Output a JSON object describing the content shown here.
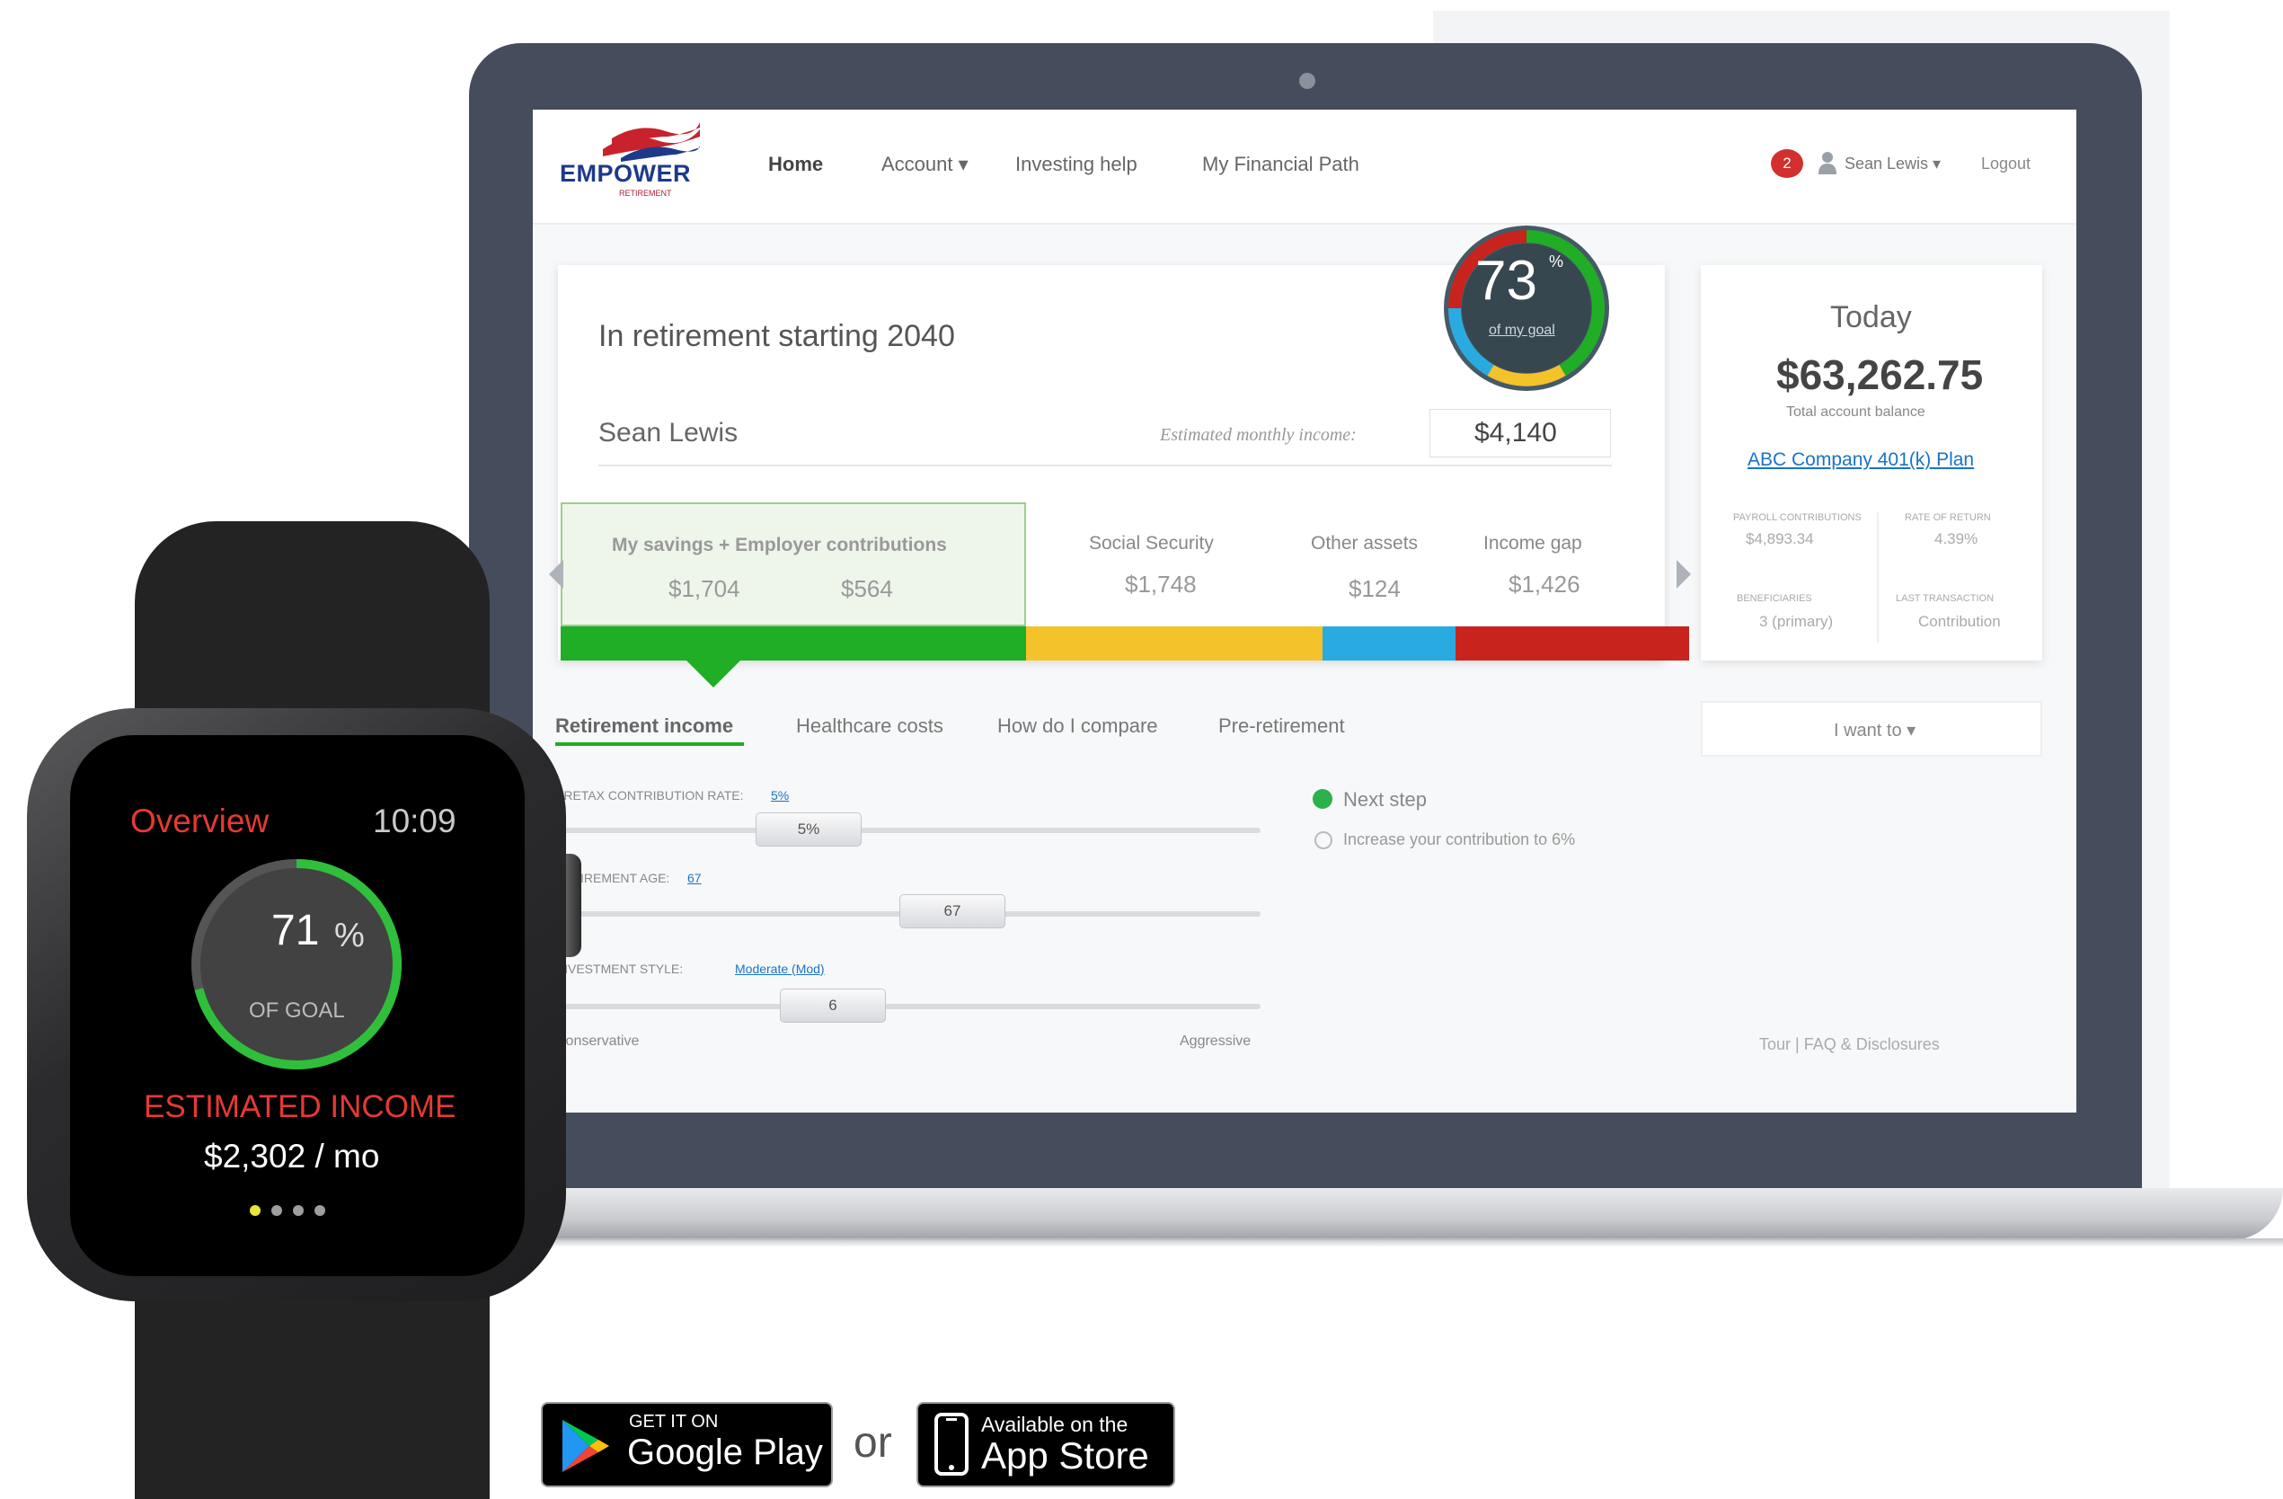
{
  "nav": {
    "logo": "EMPOWER",
    "logo_sub": "RETIREMENT",
    "home": "Home",
    "account": "Account ▾",
    "investing_help": "Investing help",
    "financial_path": "My Financial Path",
    "notification_count": "2",
    "user": "Sean Lewis ▾",
    "logout": "Logout"
  },
  "summary": {
    "title": "In retirement starting 2040",
    "name": "Sean Lewis",
    "est_label": "Estimated monthly income:",
    "est_value": "$4,140",
    "goal_percent": "73",
    "goal_percent_sign": "%",
    "goal_sub": "of my goal",
    "goal_fraction": 0.73
  },
  "breakdown": {
    "savings_label": "My savings  +  Employer contributions",
    "savings_value": "$1,704",
    "employer_value": "$564",
    "ss_label": "Social Security",
    "ss_value": "$1,748",
    "other_label": "Other assets",
    "other_value": "$124",
    "gap_label": "Income gap",
    "gap_value": "$1,426"
  },
  "today": {
    "title": "Today",
    "balance": "$63,262.75",
    "balance_label": "Total account balance",
    "plan_link": "ABC Company 401(k) Plan",
    "stats": [
      {
        "label": "PAYROLL CONTRIBUTIONS",
        "value": "$4,893.34"
      },
      {
        "label": "RATE OF RETURN",
        "value": "4.39%"
      },
      {
        "label": "BENEFICIARIES",
        "value": "3 (primary)"
      },
      {
        "label": "LAST TRANSACTION",
        "value": "Contribution"
      }
    ],
    "i_want_to": "I want to ▾"
  },
  "tabs": [
    "Retirement income",
    "Healthcare costs",
    "How do I compare",
    "Pre-retirement"
  ],
  "sliders": {
    "contribution_label": "PRETAX CONTRIBUTION RATE:",
    "contribution_link": "5%",
    "contribution_value": "5%",
    "age_label": "RETIREMENT AGE:",
    "age_link": "67",
    "age_value": "67",
    "style_label": "INVESTMENT STYLE:",
    "style_link": "Moderate (Mod)",
    "style_value": "6",
    "conservative": "Conservative",
    "aggressive": "Aggressive"
  },
  "next_step": {
    "title": "Next step",
    "item": "Increase your contribution to 6%"
  },
  "footer": "Tour  |  FAQ & Disclosures",
  "watch": {
    "title": "Overview",
    "time": "10:09",
    "percent": "71",
    "percent_sign": "%",
    "of_goal": "OF GOAL",
    "goal_fraction": 0.71,
    "est_label": "ESTIMATED INCOME",
    "est_value": "$2,302 / mo"
  },
  "stores": {
    "google_small": "GET IT ON",
    "google_big": "Google Play",
    "or": "or",
    "apple_small": "Available on the",
    "apple_big": "App Store"
  }
}
